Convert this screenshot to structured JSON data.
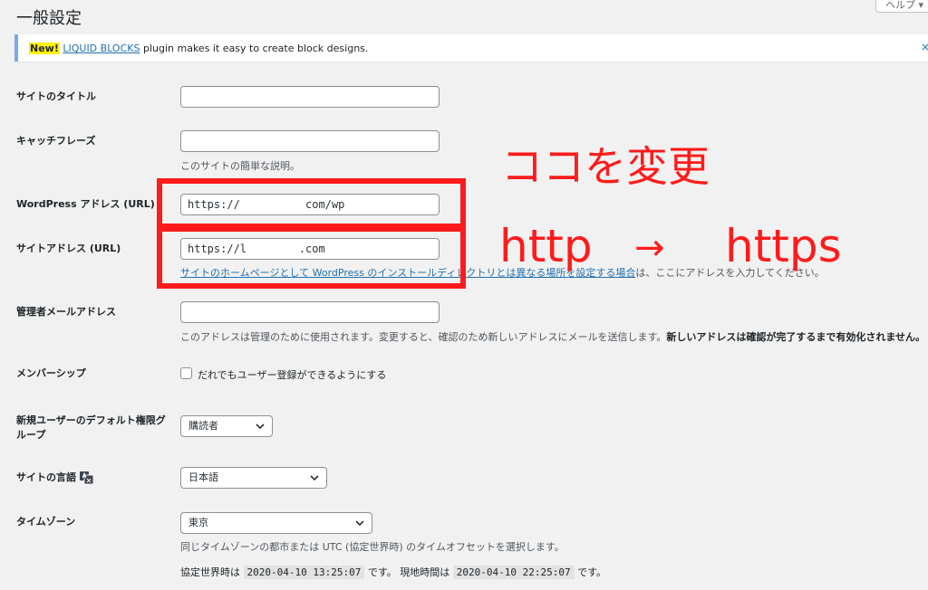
{
  "page": {
    "title": "一般設定",
    "help_tab": "ヘルプ ▾"
  },
  "notice": {
    "new_badge": "New!",
    "link_text": "LIQUID BLOCKS",
    "message": " plugin makes it easy to create block designs.",
    "dismiss": "×"
  },
  "fields": {
    "site_title": {
      "label": "サイトのタイトル",
      "value": ""
    },
    "tagline": {
      "label": "キャッチフレーズ",
      "value": "",
      "description": "このサイトの簡単な説明。"
    },
    "wp_address": {
      "label": "WordPress アドレス (URL)",
      "value": "https://          com/wp"
    },
    "site_address": {
      "label": "サイトアドレス (URL)",
      "value": "https://l        .com",
      "description_link": "サイトのホームページとして WordPress のインストールディレクトリとは異なる場所を設定する場合",
      "description_rest": "は、ここにアドレスを入力してください。"
    },
    "admin_email": {
      "label": "管理者メールアドレス",
      "value": "",
      "description": "このアドレスは管理のために使用されます。変更すると、確認のため新しいアドレスにメールを送信します。",
      "description_bold": "新しいアドレスは確認が完了するまで有効化されません。"
    },
    "membership": {
      "label": "メンバーシップ",
      "checkbox_label": "だれでもユーザー登録ができるようにする",
      "checked": false
    },
    "default_role": {
      "label_line1": "新規ユーザーのデフォルト権限グ",
      "label_line2": "ループ",
      "selected": "購読者"
    },
    "site_language": {
      "label": "サイトの言語",
      "selected": "日本語"
    },
    "timezone": {
      "label": "タイムゾーン",
      "selected": "東京",
      "description": "同じタイムゾーンの都市または UTC (協定世界時) のタイムオフセットを選択します。",
      "utc_label": "協定世界時は",
      "utc_time": "2020-04-10 13:25:07",
      "utc_suffix": "です。",
      "local_label": "現地時間は",
      "local_time": "2020-04-10 22:25:07",
      "local_suffix": "です。"
    }
  },
  "annotations": {
    "change_here": "ココを変更",
    "http": "http",
    "arrow": "→",
    "https": "https",
    "color": "#ff1b1b"
  }
}
